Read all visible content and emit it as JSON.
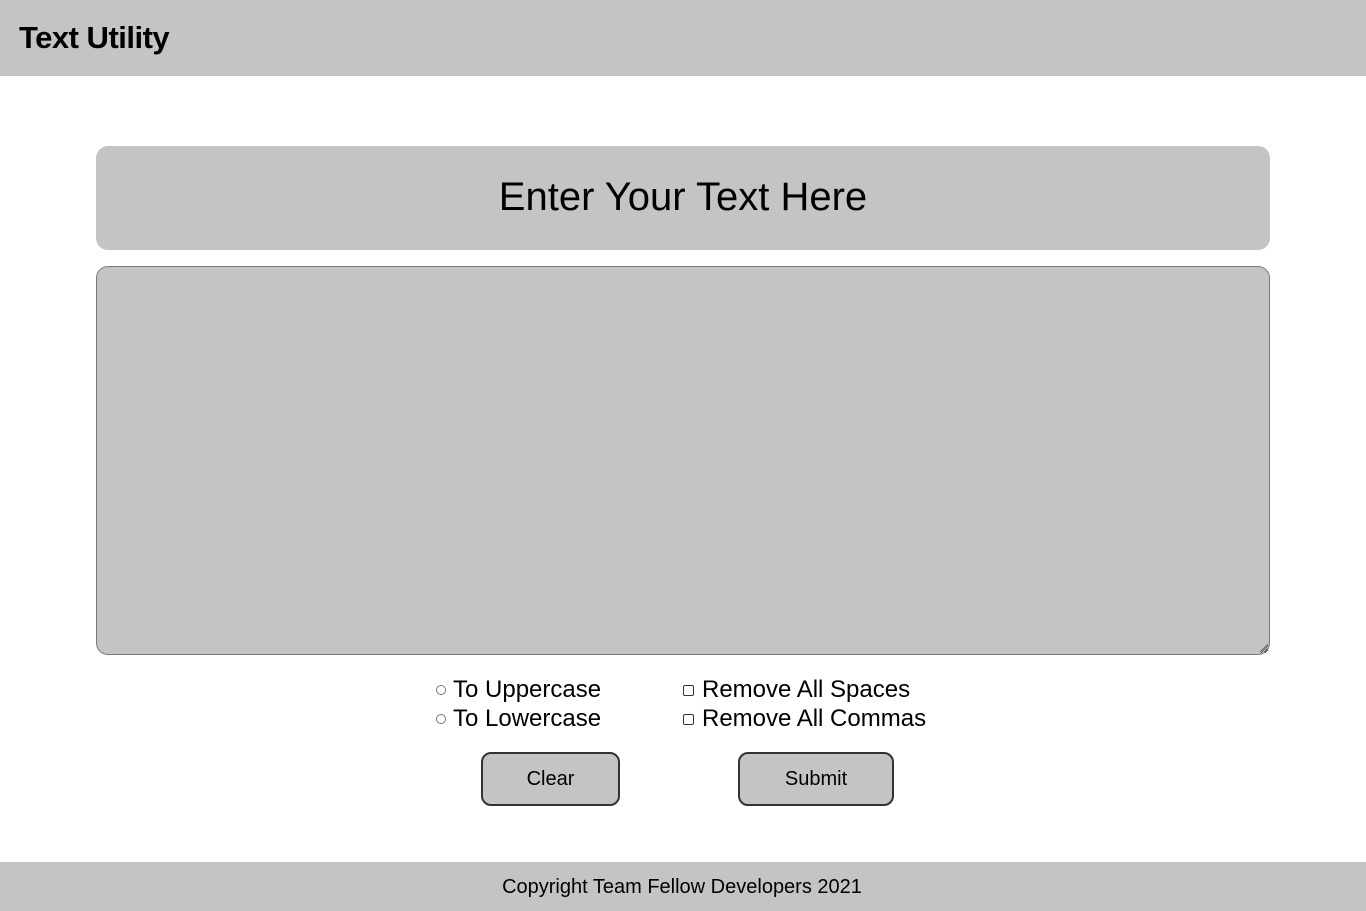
{
  "header": {
    "title": "Text Utility"
  },
  "banner": {
    "text": "Enter Your Text Here"
  },
  "editor": {
    "value": "",
    "placeholder": ""
  },
  "options": {
    "radios": [
      {
        "label": "To Uppercase",
        "checked": false
      },
      {
        "label": "To Lowercase",
        "checked": false
      }
    ],
    "checkboxes": [
      {
        "label": "Remove All Spaces",
        "checked": false
      },
      {
        "label": "Remove All Commas",
        "checked": false
      }
    ]
  },
  "buttons": {
    "clear_label": "Clear",
    "submit_label": "Submit"
  },
  "footer": {
    "text": "Copyright Team Fellow Developers 2021"
  },
  "colors": {
    "panel_gray": "#c4c4c4",
    "background": "#ffffff",
    "button_border": "#333333"
  }
}
